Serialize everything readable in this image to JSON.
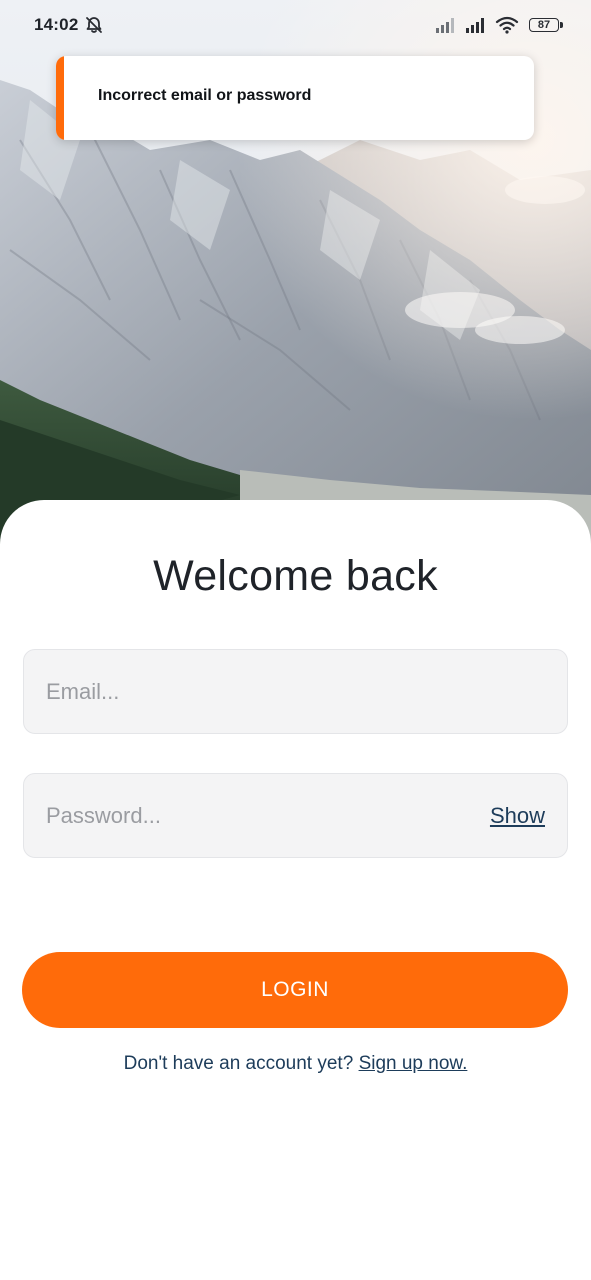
{
  "status_bar": {
    "time": "14:02",
    "battery": "87",
    "icons": [
      "bell-off-icon",
      "signal-icon",
      "signal-icon",
      "wifi-icon",
      "battery-icon"
    ]
  },
  "toast": {
    "message": "Incorrect email or password",
    "accent_color": "#ff6b0a"
  },
  "form": {
    "title": "Welcome back",
    "email_placeholder": "Email...",
    "password_placeholder": "Password...",
    "show_label": "Show",
    "login_label": "LOGIN",
    "signup_prompt": "Don't have an account yet?",
    "signup_link": "Sign up now."
  },
  "colors": {
    "accent": "#ff6b0a",
    "link": "#1d3c5a",
    "title": "#1f2329",
    "field_bg": "#f4f4f5"
  }
}
